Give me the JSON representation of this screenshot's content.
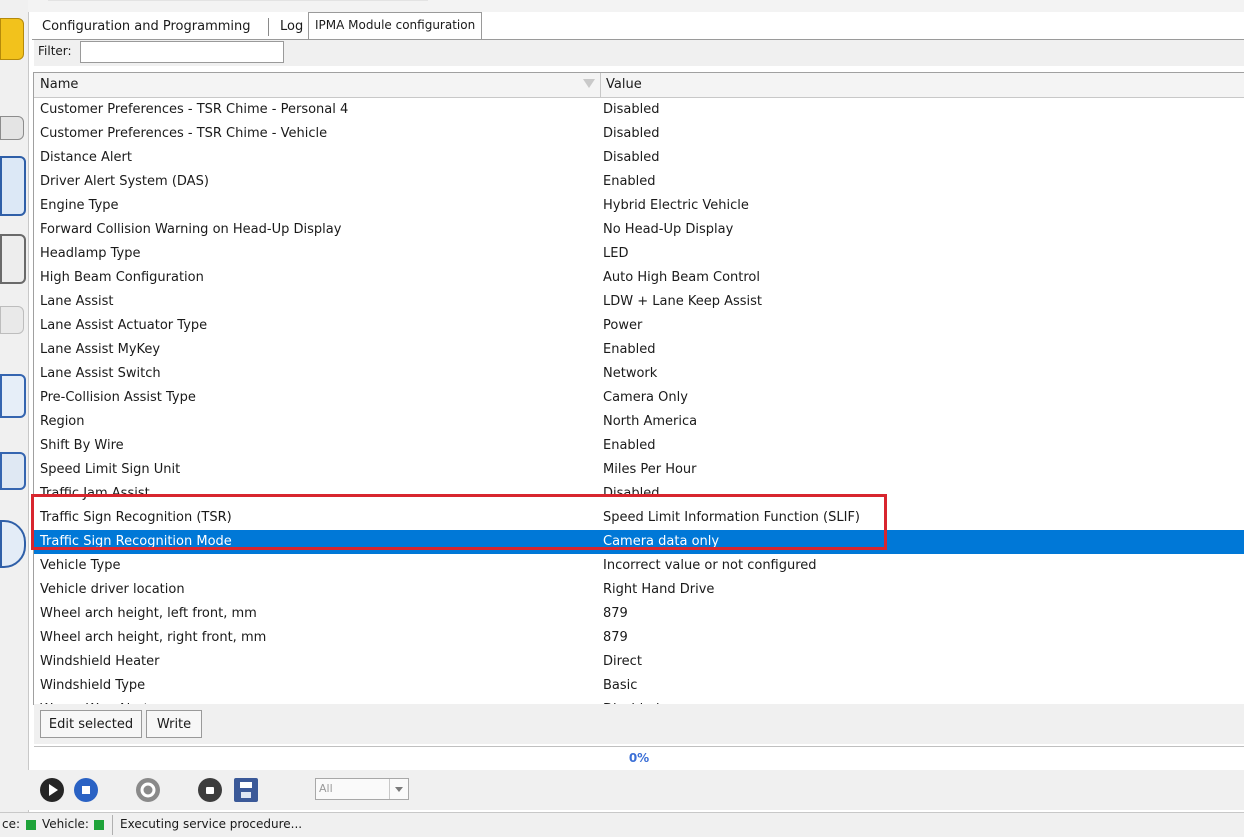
{
  "tabs": [
    {
      "label": "Configuration and Programming"
    },
    {
      "label": "Log"
    },
    {
      "label": "IPMA Module configuration"
    }
  ],
  "filter": {
    "label": "Filter:",
    "value": ""
  },
  "table": {
    "columns": [
      "Name",
      "Value"
    ],
    "rows": [
      {
        "name": "Customer Preferences - TSR Chime - Personal 4",
        "value": "Disabled"
      },
      {
        "name": "Customer Preferences - TSR Chime - Vehicle",
        "value": "Disabled"
      },
      {
        "name": "Distance Alert",
        "value": "Disabled"
      },
      {
        "name": "Driver Alert System (DAS)",
        "value": "Enabled"
      },
      {
        "name": "Engine Type",
        "value": "Hybrid Electric Vehicle"
      },
      {
        "name": "Forward Collision Warning on Head-Up Display",
        "value": "No Head-Up Display"
      },
      {
        "name": "Headlamp Type",
        "value": "LED"
      },
      {
        "name": "High Beam Configuration",
        "value": "Auto High Beam Control"
      },
      {
        "name": "Lane Assist",
        "value": "LDW + Lane Keep Assist"
      },
      {
        "name": "Lane Assist Actuator Type",
        "value": "Power"
      },
      {
        "name": "Lane Assist MyKey",
        "value": "Enabled"
      },
      {
        "name": "Lane Assist Switch",
        "value": "Network"
      },
      {
        "name": "Pre-Collision Assist Type",
        "value": "Camera Only"
      },
      {
        "name": "Region",
        "value": "North America"
      },
      {
        "name": "Shift By Wire",
        "value": "Enabled"
      },
      {
        "name": "Speed Limit Sign Unit",
        "value": "Miles Per Hour"
      },
      {
        "name": "Traffic Jam Assist",
        "value": "Disabled"
      },
      {
        "name": "Traffic Sign Recognition (TSR)",
        "value": "Speed Limit Information Function (SLIF)"
      },
      {
        "name": "Traffic Sign Recognition Mode",
        "value": "Camera data only",
        "selected": true
      },
      {
        "name": "Vehicle Type",
        "value": "Incorrect value or not configured"
      },
      {
        "name": "Vehicle driver location",
        "value": "Right Hand Drive"
      },
      {
        "name": "Wheel arch height, left front, mm",
        "value": "879"
      },
      {
        "name": "Wheel arch height, right front, mm",
        "value": "879"
      },
      {
        "name": "Windshield Heater",
        "value": "Direct"
      },
      {
        "name": "Windshield Type",
        "value": "Basic"
      },
      {
        "name": "Wrong Way Alert",
        "value": "Disabled"
      }
    ]
  },
  "buttons": {
    "edit_selected": "Edit selected",
    "write": "Write"
  },
  "progress": {
    "text": "0%",
    "fraction": 0
  },
  "toolbar": {
    "icons": [
      "play-icon",
      "stop-icon",
      "help-icon",
      "record-icon",
      "save-icon"
    ],
    "filter_select": "All"
  },
  "status": {
    "interface_label": "ce:",
    "vehicle_label": "Vehicle:",
    "message": "Executing service procedure...",
    "led_color": "#1fa33a"
  },
  "colors": {
    "selection": "#0078d7",
    "highlight_box": "#d8262e",
    "progress_text": "#3b6fd6"
  }
}
